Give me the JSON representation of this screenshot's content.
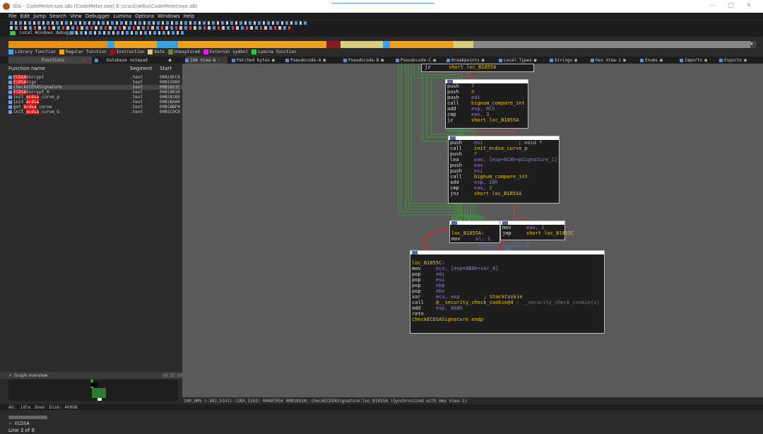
{
  "window": {
    "title": "IDA - CodeMeter.exe.idb (CodeMeter.exe) E:\\crack\\wibu\\CodeMeter.exe.idb"
  },
  "menu": [
    "File",
    "Edit",
    "Jump",
    "Search",
    "View",
    "Debugger",
    "Lumina",
    "Options",
    "Windows",
    "Help"
  ],
  "debugger": {
    "label": "Local Windows debugger"
  },
  "legend": [
    {
      "label": "Library function",
      "color": "#4aa8e8"
    },
    {
      "label": "Regular function",
      "color": "#f0a020"
    },
    {
      "label": "Instruction",
      "color": "#8b1a1a"
    },
    {
      "label": "Data",
      "color": "#d8cc80"
    },
    {
      "label": "Unexplored",
      "color": "#7a7a3a"
    },
    {
      "label": "External symbol",
      "color": "#e020d0"
    },
    {
      "label": "Lumina function",
      "color": "#40c040"
    }
  ],
  "tabs": [
    {
      "label": "Functions",
      "close": "✕"
    },
    {
      "label": "Database notepad",
      "close": "■"
    },
    {
      "label": "IDA View-A",
      "close": "✕"
    },
    {
      "label": "Patched bytes",
      "close": "■"
    },
    {
      "label": "Pseudocode-A",
      "close": "■"
    },
    {
      "label": "Pseudocode-B",
      "close": "■"
    },
    {
      "label": "Pseudocode-C",
      "close": "■"
    },
    {
      "label": "Breakpoints",
      "close": "■"
    },
    {
      "label": "Local Types",
      "close": "■"
    },
    {
      "label": "Strings",
      "close": "■"
    },
    {
      "label": "Hex View-1",
      "close": "■"
    },
    {
      "label": "Enums",
      "close": "■"
    },
    {
      "label": "Imports",
      "close": "■"
    },
    {
      "label": "Exports",
      "close": "■"
    }
  ],
  "functions": {
    "headers": {
      "name": "Function name",
      "segment": "Segment",
      "start": "Start"
    },
    "rows": [
      {
        "pre": "",
        "red": "ECDSA",
        "post": "Encrypt",
        "seg": ".text",
        "start": "00A10FC0"
      },
      {
        "pre": "",
        "red": "ECDSA",
        "post": "Sign",
        "seg": ".text",
        "start": "00B15080"
      },
      {
        "pre": "check",
        "red": "",
        "post": "ECDSASignature",
        "seg": ".text",
        "start": "00B1833C"
      },
      {
        "pre": "",
        "red": "ECDSA",
        "post": "Encrypt_0",
        "seg": ".text",
        "start": "00B18830"
      },
      {
        "pre": "init_",
        "red": "ecdsa",
        "post": "_curve_p",
        "seg": ".text",
        "start": "00B1B1B0"
      },
      {
        "pre": "init_",
        "red": "ecdsa",
        "post": "",
        "seg": ".text",
        "start": "00B1BAA0"
      },
      {
        "pre": "get_",
        "red": "ecdsa",
        "post": "_curve",
        "seg": ".text",
        "start": "00B1BBF0"
      },
      {
        "pre": "init_",
        "red": "ecdsa",
        "post": "_curve_G",
        "seg": ".text",
        "start": "00B1C9C0"
      }
    ],
    "filter": "ECDSA",
    "line_info": "Line 3 of 8"
  },
  "graph_overview": {
    "label": "Graph overview"
  },
  "status": "100.00% (-302,5141) (289,1163) 0048795A 00B1855A: checkECDSASignature:loc_B1855A (Synchronized with Hex View-1)",
  "bottom": {
    "au": "AU:",
    "state": "idle",
    "dir": "Down",
    "disk": "Disk: 400GB"
  },
  "graph_nodes": {
    "n0": {
      "lines": [
        [
          "jz",
          "short loc_B1855A"
        ]
      ]
    },
    "n1": {
      "lines": [
        [
          "push",
          "7"
        ],
        [
          "push",
          "8"
        ],
        [
          "push",
          "edi"
        ],
        [
          "call",
          "bignum_compare_int"
        ],
        [
          "add",
          "esp, 0Ch"
        ],
        [
          "cmp",
          "eax, 3"
        ],
        [
          "jz",
          "short loc_B1855A"
        ]
      ]
    },
    "n2": {
      "lines": [
        [
          "push",
          "esi"
        ],
        [
          "call",
          "init_ecdsa_curve_p"
        ],
        [
          "push",
          "7"
        ],
        [
          "lea",
          "eax, [esp+0C8h+pSignature_1]"
        ],
        [
          "push",
          "eax"
        ],
        [
          "push",
          "esi"
        ],
        [
          "call",
          "bignum_compare_int"
        ],
        [
          "add",
          "esp, 10h"
        ],
        [
          "cmp",
          "eax, 3"
        ],
        [
          "jnz",
          "short loc_B1855A"
        ]
      ],
      "comment": "; void *"
    },
    "n3": {
      "label": "loc_B1855A:",
      "lines": [
        [
          "mov",
          "al, 1"
        ]
      ]
    },
    "n4": {
      "lines": [
        [
          "mov",
          "eax, 1"
        ],
        [
          "jmp",
          "short loc_B1855C"
        ]
      ]
    },
    "n5": {
      "label": "loc_B1855C:",
      "lines": [
        [
          "mov",
          "ecx, [esp+0B8h+var_4]"
        ],
        [
          "pop",
          "edi"
        ],
        [
          "pop",
          "esi"
        ],
        [
          "pop",
          "ebp"
        ],
        [
          "pop",
          "ebx"
        ],
        [
          "xor",
          "ecx, esp"
        ],
        [
          "call",
          "@__security_check_cookie@4"
        ],
        [
          "add",
          "esp, 0A8h"
        ],
        [
          "retn",
          ""
        ]
      ],
      "cookie_comment": "; StackCookie",
      "call_comment": "; __security_check_cookie(x)",
      "endp": "checkECDSASignature endp"
    }
  }
}
